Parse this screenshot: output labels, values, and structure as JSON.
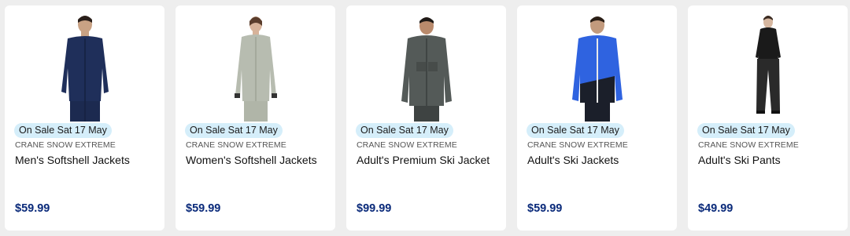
{
  "products": [
    {
      "badge": "On Sale Sat 17 May",
      "brand": "CRANE SNOW EXTREME",
      "title": "Men's Softshell Jackets",
      "price": "$59.99",
      "image": {
        "icon": "mens-softshell-jacket-photo",
        "garment_color": "#1f2f5a",
        "pants_color": "#1f2f5a",
        "type": "jacket"
      }
    },
    {
      "badge": "On Sale Sat 17 May",
      "brand": "CRANE SNOW EXTREME",
      "title": "Women's Softshell Jackets",
      "price": "$59.99",
      "image": {
        "icon": "womens-softshell-jacket-photo",
        "garment_color": "#b7bcb0",
        "pants_color": "#b7bcb0",
        "type": "jacket-female"
      }
    },
    {
      "badge": "On Sale Sat 17 May",
      "brand": "CRANE SNOW EXTREME",
      "title": "Adult's Premium Ski Jacket",
      "price": "$99.99",
      "image": {
        "icon": "premium-ski-jacket-photo",
        "garment_color": "#545a58",
        "pants_color": "#3e4342",
        "type": "jacket"
      }
    },
    {
      "badge": "On Sale Sat 17 May",
      "brand": "CRANE SNOW EXTREME",
      "title": "Adult's Ski Jackets",
      "price": "$59.99",
      "image": {
        "icon": "ski-jacket-photo",
        "garment_color": "#2f63e0",
        "pants_color": "#1b1f2a",
        "type": "ski-jacket"
      }
    },
    {
      "badge": "On Sale Sat 17 May",
      "brand": "CRANE SNOW EXTREME",
      "title": "Adult's Ski Pants",
      "price": "$49.99",
      "image": {
        "icon": "ski-pants-photo",
        "garment_color": "#1a1a1a",
        "pants_color": "#2a2a2a",
        "type": "pants"
      }
    }
  ],
  "colors": {
    "badge_bg": "#d5eefa",
    "price": "#0a2a7a",
    "card_bg": "#ffffff",
    "page_bg": "#eeeeee"
  }
}
